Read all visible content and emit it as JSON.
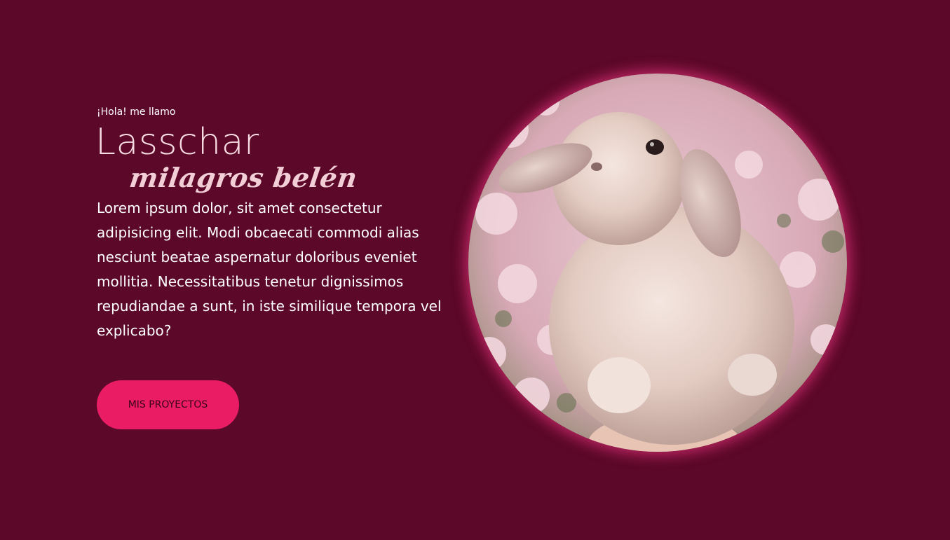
{
  "hero": {
    "greeting": "¡Hola! me llamo",
    "name": "Lasschar",
    "subname": "milagros belén",
    "bio": "Lorem ipsum dolor, sit amet consectetur adipisicing elit. Modi obcaecati commodi alias nesciunt beatae aspernatur doloribus eveniet mollitia. Necessitatibus tenetur dignissimos repudiandae a sunt, in iste similique tempora vel explicabo?",
    "cta_label": "MIS PROYECTOS"
  },
  "colors": {
    "background": "#5c0828",
    "accent": "#ea1c63",
    "name_text": "#f6dce2"
  },
  "portrait": {
    "subject": "bunny-photo"
  }
}
